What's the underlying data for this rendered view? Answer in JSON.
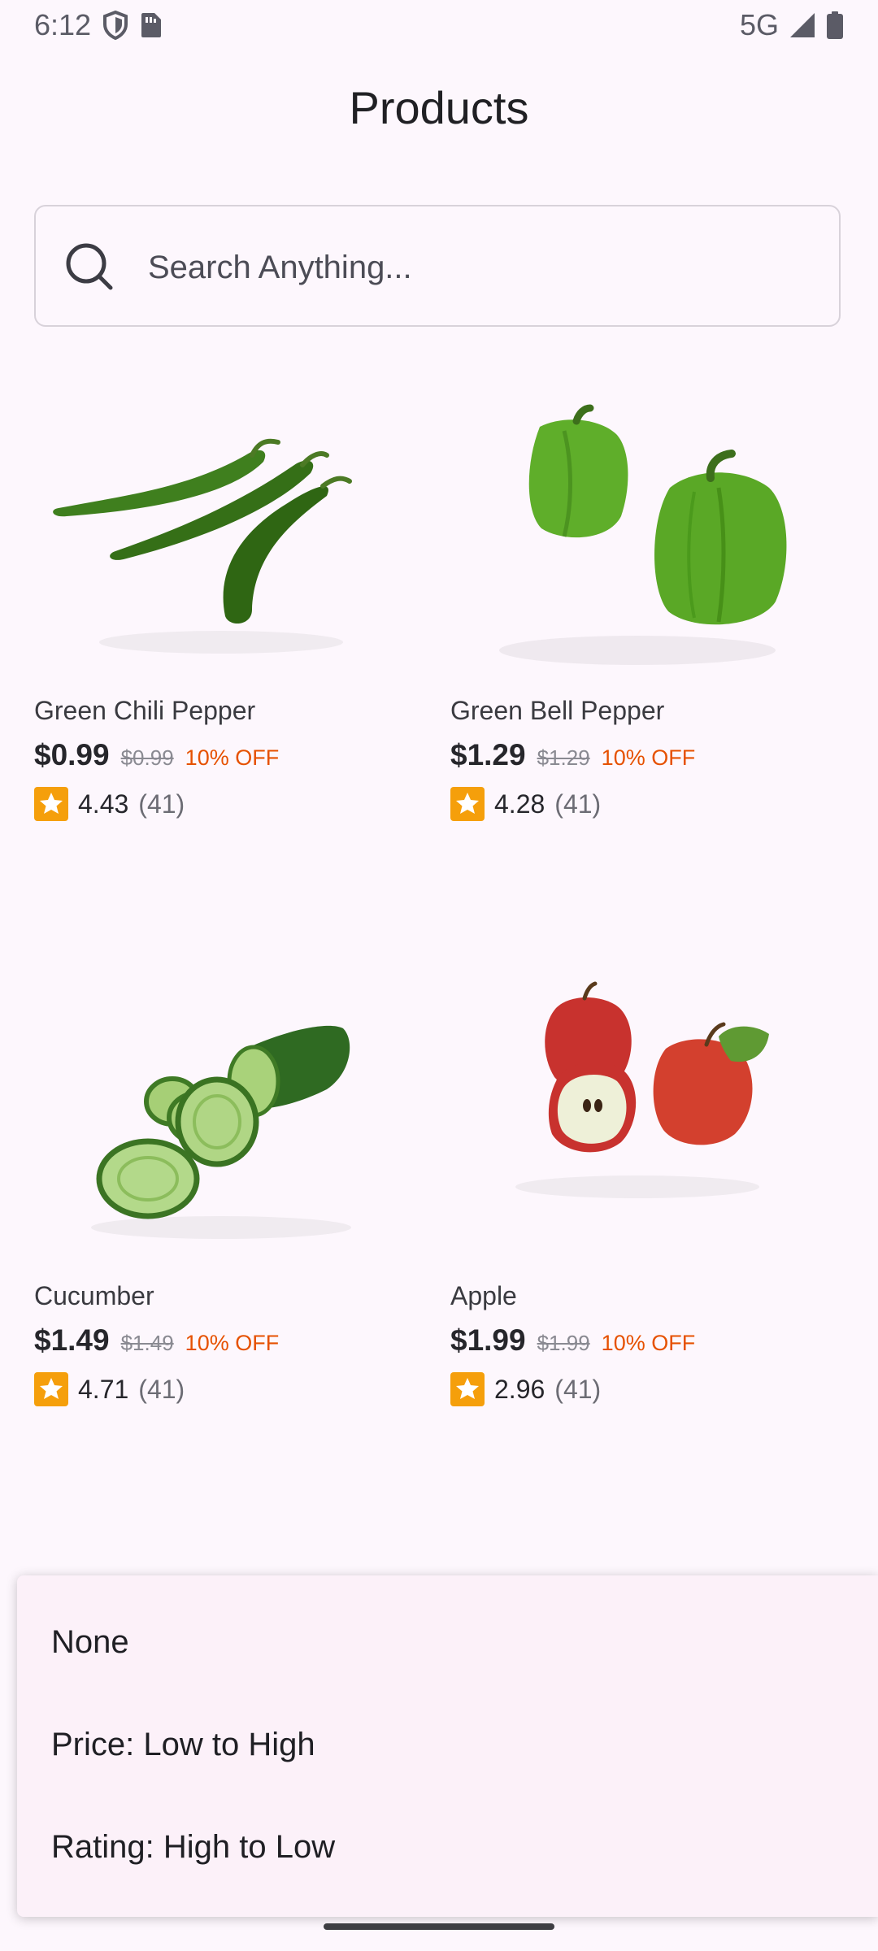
{
  "status_bar": {
    "time": "6:12",
    "network": "5G"
  },
  "page": {
    "title": "Products"
  },
  "search": {
    "placeholder": "Search Anything...",
    "value": ""
  },
  "products": [
    {
      "name": "Green Chili Pepper",
      "price": "$0.99",
      "original_price": "$0.99",
      "discount": "10% OFF",
      "rating": "4.43",
      "rating_count": "(41)"
    },
    {
      "name": "Green Bell Pepper",
      "price": "$1.29",
      "original_price": "$1.29",
      "discount": "10% OFF",
      "rating": "4.28",
      "rating_count": "(41)"
    },
    {
      "name": "Cucumber",
      "price": "$1.49",
      "original_price": "$1.49",
      "discount": "10% OFF",
      "rating": "4.71",
      "rating_count": "(41)"
    },
    {
      "name": "Apple",
      "price": "$1.99",
      "original_price": "$1.99",
      "discount": "10% OFF",
      "rating": "2.96",
      "rating_count": "(41)"
    }
  ],
  "sort_sheet": {
    "options": [
      "None",
      "Price: Low to High",
      "Rating: High to Low"
    ]
  },
  "colors": {
    "background": "#fdf7fd",
    "discount": "#e65100",
    "star_badge": "#f59f0b",
    "sheet": "#fcf1f9"
  },
  "icons": [
    "shield-icon",
    "sim-card-icon",
    "signal-icon",
    "battery-icon",
    "search-icon",
    "star-icon"
  ]
}
